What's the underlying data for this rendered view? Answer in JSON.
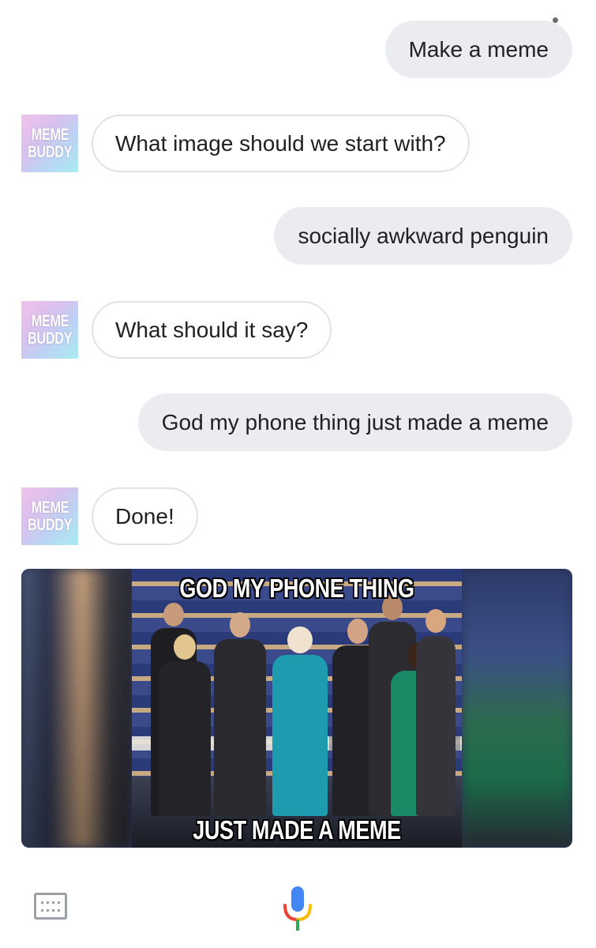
{
  "conversation": {
    "user_messages": [
      "Make a meme",
      "socially awkward penguin",
      "God my phone thing just made a meme"
    ],
    "bot_messages": [
      "What image should we start with?",
      "What should it say?",
      "Done!"
    ],
    "bot_avatar": {
      "line1": "MEME",
      "line2": "BUDDY"
    }
  },
  "meme": {
    "top_text": "GOD MY PHONE THING",
    "bottom_text": "JUST MADE A MEME"
  },
  "bottom_bar": {
    "keyboard_icon": "keyboard-icon",
    "mic_icon": "microphone-icon"
  },
  "colors": {
    "user_bubble": "#eaecef",
    "bot_bubble_border": "#e0e2e5",
    "mic_blue": "#4285f4",
    "mic_red": "#ea4335",
    "mic_yellow": "#fbbc05",
    "mic_green": "#34a853"
  }
}
